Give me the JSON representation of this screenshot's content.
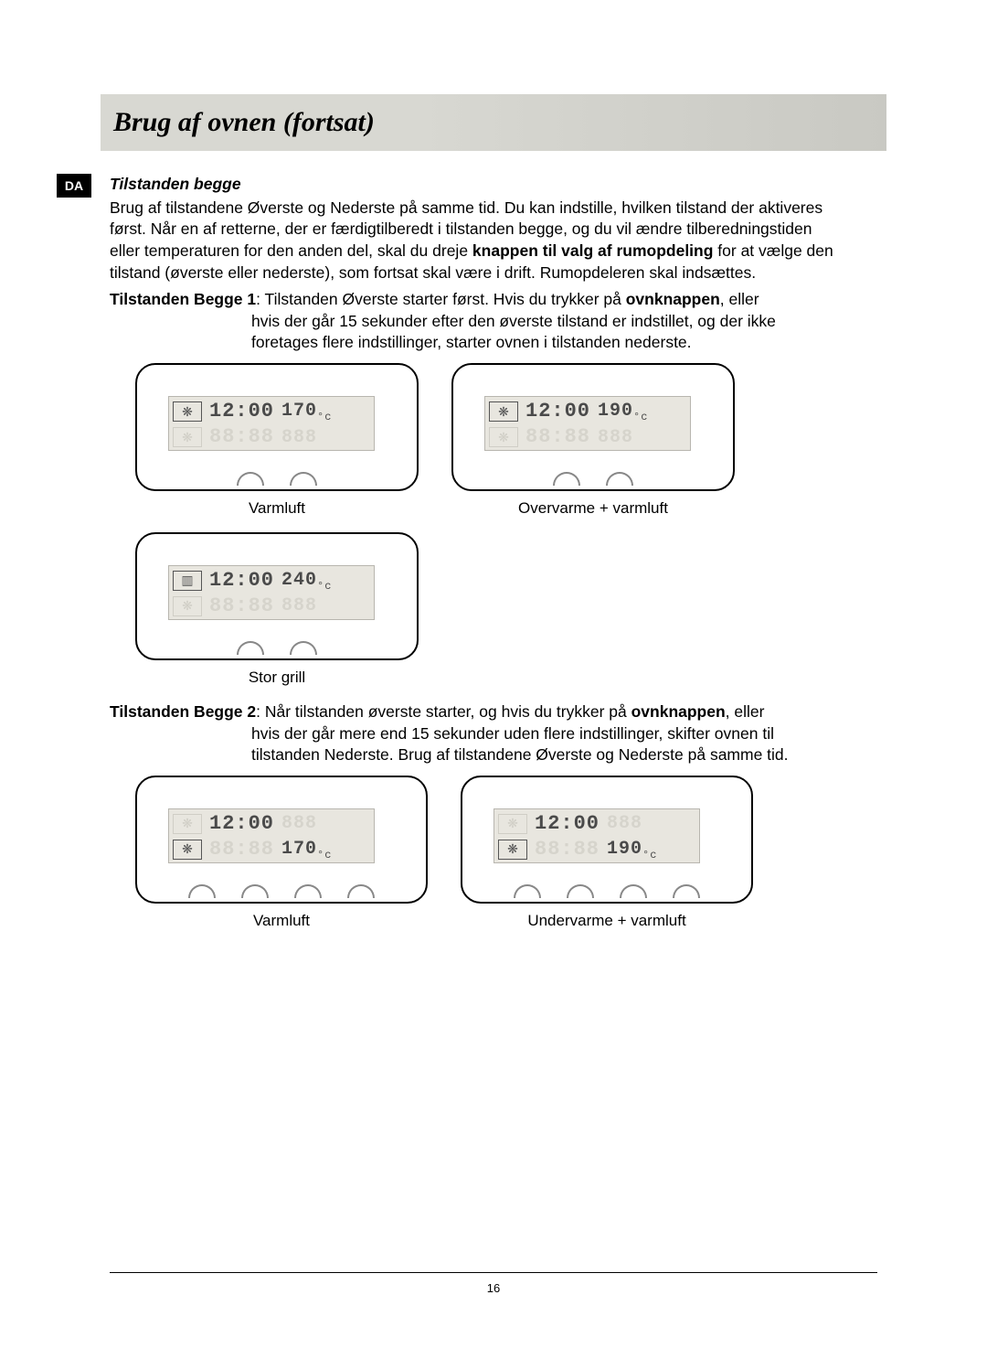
{
  "header": {
    "title": "Brug af ovnen (fortsat)"
  },
  "lang_tab": "DA",
  "section": {
    "subheading": "Tilstanden begge",
    "intro_a": "Brug af tilstandene Øverste og Nederste på samme tid. Du kan indstille, hvilken tilstand der aktiveres først. Når en af retterne, der er færdigtilberedt i tilstanden begge, og du vil ændre tilberedningstiden eller temperaturen for den anden del, skal du dreje ",
    "intro_b": "knappen til valg af rumopdeling",
    "intro_c": " for at vælge den tilstand (øverste eller nederste), som fortsat skal være i drift. Rumopdeleren skal indsættes.",
    "state1_lead": "Tilstanden Begge 1",
    "state1_text_a": ": Tilstanden Øverste starter først. Hvis du trykker på ",
    "state1_bold": "ovnknappen",
    "state1_text_b": ", eller hvis der går 15 sekunder efter den øverste tilstand er indstillet, og der ikke foretages flere indstillinger, starter ovnen i tilstanden nederste.",
    "state2_lead": "Tilstanden Begge 2",
    "state2_text_a": ": Når tilstanden øverste starter, og hvis du trykker på ",
    "state2_bold": "ovnknappen",
    "state2_text_b": ", eller hvis der går mere end 15 sekunder uden flere indstillinger, skifter ovnen til tilstanden Nederste. Brug af tilstandene Øverste og Nederste på samme tid."
  },
  "displays": {
    "time": "12:00",
    "dim_time": "88:88",
    "dim_temp": "888",
    "r1c1": {
      "temp": "170",
      "caption": "Varmluft",
      "icon": "fan"
    },
    "r1c2": {
      "temp": "190",
      "caption": "Overvarme + varmluft",
      "icon": "fan"
    },
    "r2c1": {
      "temp": "240",
      "caption": "Stor grill",
      "icon": "grill"
    },
    "r3c1": {
      "temp": "170",
      "caption": "Varmluft",
      "icon": "fan",
      "bottom_active": true
    },
    "r3c2": {
      "temp": "190",
      "caption": "Undervarme + varmluft",
      "icon": "fan",
      "bottom_active": true
    }
  },
  "page_number": "16"
}
